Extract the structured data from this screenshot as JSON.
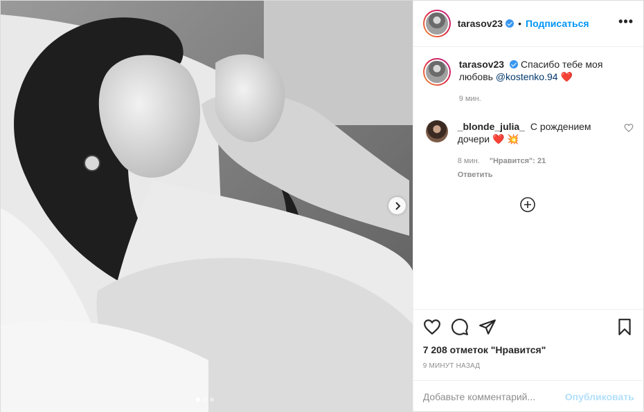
{
  "header": {
    "username": "tarasov23",
    "separator": "•",
    "follow_label": "Подписаться",
    "more_label": "•••"
  },
  "caption": {
    "username": "tarasov23",
    "text": "Спасибо тебе моя любовь",
    "mention": "@kostenko.94",
    "emoji": "❤️",
    "time": "9 мин."
  },
  "comments": [
    {
      "username": "_blonde_julia_",
      "text": "С рождением дочери",
      "emoji": "❤️ 💥",
      "time": "8 мин.",
      "likes": "\"Нравится\": 21",
      "reply_label": "Ответить"
    }
  ],
  "likes_text": "7 208 отметок \"Нравится\"",
  "posted_ago": "9 минут назад",
  "add_comment": {
    "placeholder": "Добавьте комментарий...",
    "publish_label": "Опубликовать"
  },
  "carousel": {
    "slides": 3,
    "active_index": 0
  },
  "icons": [
    "verified-icon",
    "more-icon",
    "heart-icon",
    "comment-icon",
    "share-icon",
    "save-icon",
    "chevron-right-icon",
    "plus-circle-icon"
  ],
  "colors": {
    "accent": "#0095f6",
    "publish_disabled": "#b2dffc",
    "like_red": "#ed1c24"
  }
}
